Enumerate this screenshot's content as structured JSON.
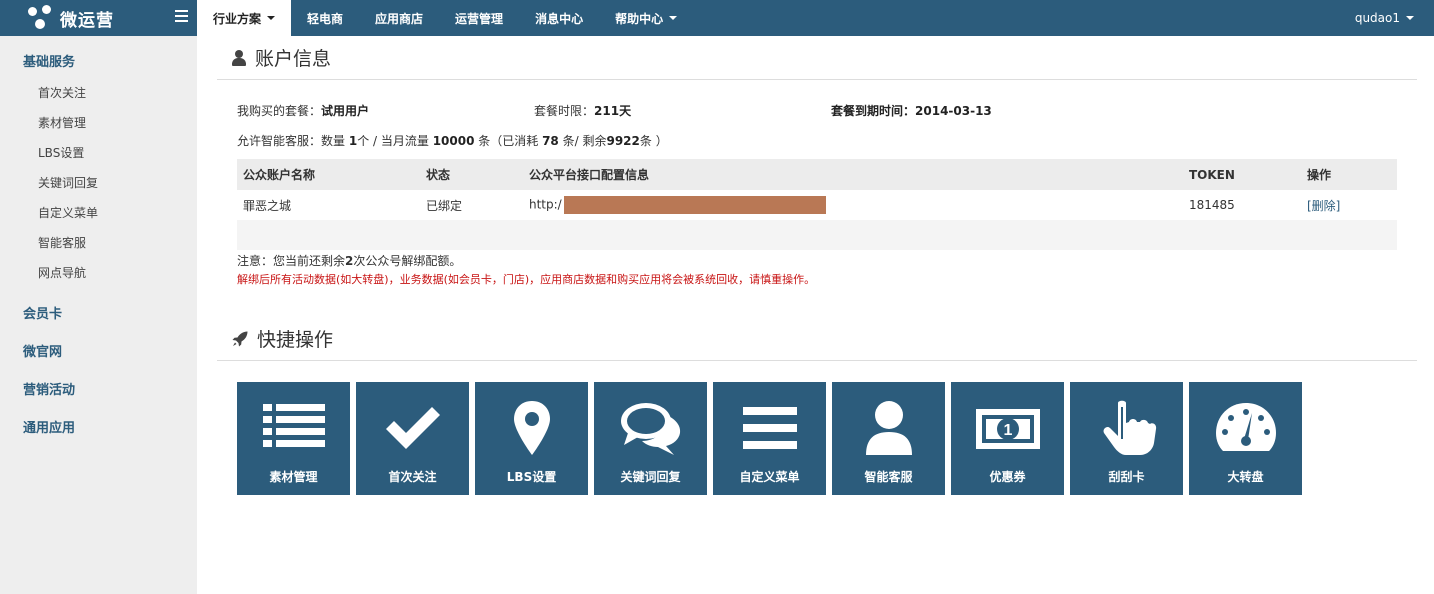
{
  "brand": {
    "name": "微运营"
  },
  "nav": [
    {
      "label": "行业方案",
      "dropdown": true,
      "active": true
    },
    {
      "label": "轻电商"
    },
    {
      "label": "应用商店"
    },
    {
      "label": "运营管理"
    },
    {
      "label": "消息中心"
    },
    {
      "label": "帮助中心",
      "dropdown": true
    }
  ],
  "user": {
    "name": "qudao1"
  },
  "sidebar": {
    "basic": {
      "label": "基础服务",
      "items": [
        "首次关注",
        "素材管理",
        "LBS设置",
        "关键词回复",
        "自定义菜单",
        "智能客服",
        "网点导航"
      ]
    },
    "others": [
      "会员卡",
      "微官网",
      "营销活动",
      "通用应用"
    ]
  },
  "account": {
    "title": "账户信息",
    "package_label": "我购买的套餐：",
    "package_value": "试用用户",
    "period_label": "套餐时限：",
    "period_value": "211天",
    "expire_label": "套餐到期时间：",
    "expire_value": "2014-03-13",
    "service_prefix": "允许智能客服：数量 ",
    "service_count": "1",
    "service_mid1": "个 / 当月流量 ",
    "service_flow": "10000",
    "service_mid2": " 条（已消耗 ",
    "service_used": "78",
    "service_mid3": " 条/ 剩余",
    "service_left": "9922",
    "service_suffix": "条 ）",
    "table": {
      "headers": [
        "公众账户名称",
        "状态",
        "公众平台接口配置信息",
        "TOKEN",
        "操作"
      ],
      "row": {
        "name": "罪恶之城",
        "status": "已绑定",
        "url_prefix": "http:/",
        "token": "181485",
        "action": "[删除]"
      }
    },
    "note_prefix": "注意：您当前还剩余",
    "note_count": "2",
    "note_suffix": "次公众号解绑配额。",
    "warning": "解绑后所有活动数据(如大转盘)，业务数据(如会员卡，门店)，应用商店数据和购买应用将会被系统回收，请慎重操作。"
  },
  "quick": {
    "title": "快捷操作",
    "tiles": [
      {
        "label": "素材管理",
        "icon": "list-icon"
      },
      {
        "label": "首次关注",
        "icon": "check-icon"
      },
      {
        "label": "LBS设置",
        "icon": "map-marker-icon"
      },
      {
        "label": "关键词回复",
        "icon": "chat-bubbles-icon"
      },
      {
        "label": "自定义菜单",
        "icon": "menu-bars-icon"
      },
      {
        "label": "智能客服",
        "icon": "user-icon"
      },
      {
        "label": "优惠券",
        "icon": "money-icon"
      },
      {
        "label": "刮刮卡",
        "icon": "hand-pointer-icon"
      },
      {
        "label": "大转盘",
        "icon": "dashboard-icon"
      }
    ]
  },
  "colors": {
    "primary": "#2c5c7c",
    "sidebar_bg": "#eeeeee",
    "warning": "#c81414",
    "redaction": "#b97855"
  }
}
